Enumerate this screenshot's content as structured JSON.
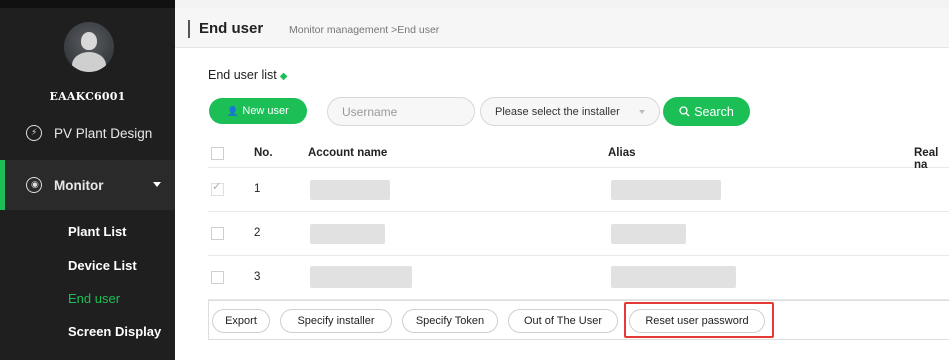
{
  "sidebar": {
    "username": "EAAKC6001",
    "pv_label": "PV Plant Design",
    "monitor_label": "Monitor",
    "sub_items": [
      "Plant List",
      "Device List",
      "End user",
      "Screen Display"
    ]
  },
  "header": {
    "title": "End user",
    "breadcrumb": "Monitor management >End user"
  },
  "list": {
    "title": "End user list",
    "new_user_label": "New user",
    "username_placeholder": "Username",
    "installer_select": "Please select the installer",
    "search_label": "Search"
  },
  "table": {
    "headers": [
      "No.",
      "Account name",
      "Alias",
      "Real na"
    ],
    "rows": [
      {
        "no": "1",
        "checked": true
      },
      {
        "no": "2",
        "checked": false
      },
      {
        "no": "3",
        "checked": false
      }
    ]
  },
  "actions": [
    "Export",
    "Specify installer",
    "Specify Token",
    "Out of The User",
    "Reset user password"
  ],
  "colors": {
    "accent": "#1bbf56",
    "highlight": "#e53935",
    "sidebar": "#1f1f1f"
  }
}
